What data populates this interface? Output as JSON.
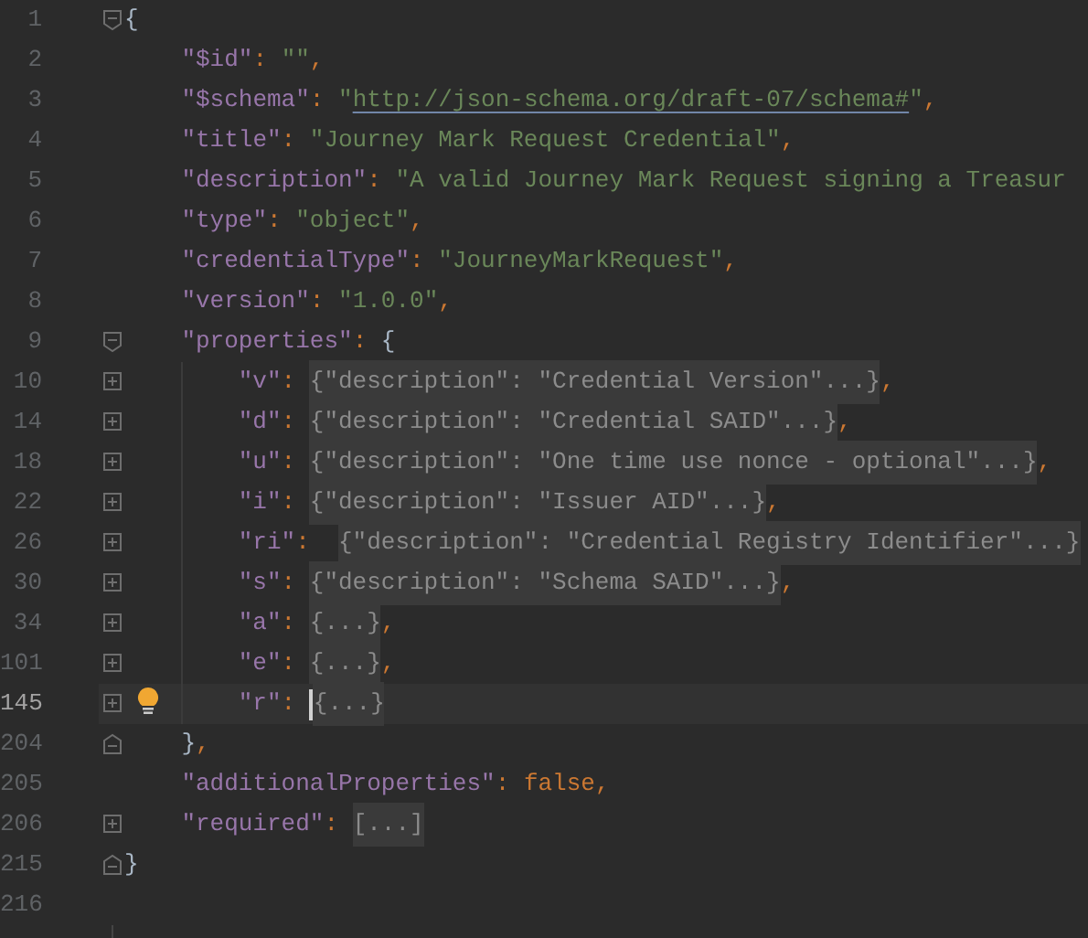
{
  "editor": {
    "lines": [
      {
        "number": "1",
        "expanded": true,
        "tokens": [
          {
            "kind": "brace",
            "text": "{"
          }
        ],
        "children": [
          {
            "number": "2",
            "tokens": [
              {
                "kind": "key",
                "text": "\"$id\""
              },
              {
                "kind": "punct",
                "text": ": "
              },
              {
                "kind": "string",
                "text": "\"\""
              },
              {
                "kind": "punct",
                "text": ","
              }
            ]
          },
          {
            "number": "3",
            "tokens": [
              {
                "kind": "key",
                "text": "\"$schema\""
              },
              {
                "kind": "punct",
                "text": ": "
              },
              {
                "kind": "string",
                "text": "\""
              },
              {
                "kind": "link",
                "text": "http://json-schema.org/draft-07/schema#"
              },
              {
                "kind": "string",
                "text": "\""
              },
              {
                "kind": "punct",
                "text": ","
              }
            ]
          },
          {
            "number": "4",
            "tokens": [
              {
                "kind": "key",
                "text": "\"title\""
              },
              {
                "kind": "punct",
                "text": ": "
              },
              {
                "kind": "string",
                "text": "\"Journey Mark Request Credential\""
              },
              {
                "kind": "punct",
                "text": ","
              }
            ]
          },
          {
            "number": "5",
            "tokens": [
              {
                "kind": "key",
                "text": "\"description\""
              },
              {
                "kind": "punct",
                "text": ": "
              },
              {
                "kind": "string",
                "text": "\"A valid Journey Mark Request signing a Treasur"
              }
            ]
          },
          {
            "number": "6",
            "tokens": [
              {
                "kind": "key",
                "text": "\"type\""
              },
              {
                "kind": "punct",
                "text": ": "
              },
              {
                "kind": "string",
                "text": "\"object\""
              },
              {
                "kind": "punct",
                "text": ","
              }
            ]
          },
          {
            "number": "7",
            "tokens": [
              {
                "kind": "key",
                "text": "\"credentialType\""
              },
              {
                "kind": "punct",
                "text": ": "
              },
              {
                "kind": "string",
                "text": "\"JourneyMarkRequest\""
              },
              {
                "kind": "punct",
                "text": ","
              }
            ]
          },
          {
            "number": "8",
            "tokens": [
              {
                "kind": "key",
                "text": "\"version\""
              },
              {
                "kind": "punct",
                "text": ": "
              },
              {
                "kind": "string",
                "text": "\"1.0.0\""
              },
              {
                "kind": "punct",
                "text": ","
              }
            ]
          },
          {
            "number": "9",
            "expanded": true,
            "tokens": [
              {
                "kind": "key",
                "text": "\"properties\""
              },
              {
                "kind": "punct",
                "text": ": "
              },
              {
                "kind": "brace",
                "text": "{"
              }
            ],
            "children": [
              {
                "number": "10",
                "expanded": false,
                "tokens": [
                  {
                    "kind": "key",
                    "text": "\"v\""
                  },
                  {
                    "kind": "punct",
                    "text": ": "
                  },
                  {
                    "kind": "folded",
                    "text": "{\"description\": \"Credential Version\"...}"
                  },
                  {
                    "kind": "punct",
                    "text": ","
                  }
                ]
              },
              {
                "number": "14",
                "expanded": false,
                "tokens": [
                  {
                    "kind": "key",
                    "text": "\"d\""
                  },
                  {
                    "kind": "punct",
                    "text": ": "
                  },
                  {
                    "kind": "folded",
                    "text": "{\"description\": \"Credential SAID\"...}"
                  },
                  {
                    "kind": "punct",
                    "text": ","
                  }
                ]
              },
              {
                "number": "18",
                "expanded": false,
                "tokens": [
                  {
                    "kind": "key",
                    "text": "\"u\""
                  },
                  {
                    "kind": "punct",
                    "text": ": "
                  },
                  {
                    "kind": "folded",
                    "text": "{\"description\": \"One time use nonce - optional\"...}"
                  },
                  {
                    "kind": "punct",
                    "text": ","
                  }
                ]
              },
              {
                "number": "22",
                "expanded": false,
                "tokens": [
                  {
                    "kind": "key",
                    "text": "\"i\""
                  },
                  {
                    "kind": "punct",
                    "text": ": "
                  },
                  {
                    "kind": "folded",
                    "text": "{\"description\": \"Issuer AID\"...}"
                  },
                  {
                    "kind": "punct",
                    "text": ","
                  }
                ]
              },
              {
                "number": "26",
                "expanded": false,
                "tokens": [
                  {
                    "kind": "key",
                    "text": "\"ri\""
                  },
                  {
                    "kind": "punct",
                    "text": ":  "
                  },
                  {
                    "kind": "folded",
                    "text": "{\"description\": \"Credential Registry Identifier\"...}"
                  }
                ]
              },
              {
                "number": "30",
                "expanded": false,
                "tokens": [
                  {
                    "kind": "key",
                    "text": "\"s\""
                  },
                  {
                    "kind": "punct",
                    "text": ": "
                  },
                  {
                    "kind": "folded",
                    "text": "{\"description\": \"Schema SAID\"...}"
                  },
                  {
                    "kind": "punct",
                    "text": ","
                  }
                ]
              },
              {
                "number": "34",
                "expanded": false,
                "tokens": [
                  {
                    "kind": "key",
                    "text": "\"a\""
                  },
                  {
                    "kind": "punct",
                    "text": ": "
                  },
                  {
                    "kind": "folded",
                    "text": "{...}"
                  },
                  {
                    "kind": "punct",
                    "text": ","
                  }
                ]
              },
              {
                "number": "101",
                "expanded": false,
                "tokens": [
                  {
                    "kind": "key",
                    "text": "\"e\""
                  },
                  {
                    "kind": "punct",
                    "text": ": "
                  },
                  {
                    "kind": "folded",
                    "text": "{...}"
                  },
                  {
                    "kind": "punct",
                    "text": ","
                  }
                ]
              },
              {
                "number": "145",
                "expanded": false,
                "current": true,
                "bulb": true,
                "tokens": [
                  {
                    "kind": "key",
                    "text": "\"r\""
                  },
                  {
                    "kind": "punct",
                    "text": ": "
                  },
                  {
                    "kind": "folded",
                    "text": "{...}",
                    "cursor": true
                  }
                ]
              }
            ]
          },
          {
            "number": "204",
            "fold_end": true,
            "tokens": [
              {
                "kind": "brace",
                "text": "}"
              },
              {
                "kind": "punct",
                "text": ","
              }
            ]
          },
          {
            "number": "205",
            "tokens": [
              {
                "kind": "key",
                "text": "\"additionalProperties\""
              },
              {
                "kind": "punct",
                "text": ": "
              },
              {
                "kind": "keyword",
                "text": "false"
              },
              {
                "kind": "punct",
                "text": ","
              }
            ]
          },
          {
            "number": "206",
            "expanded": false,
            "tokens": [
              {
                "kind": "key",
                "text": "\"required\""
              },
              {
                "kind": "punct",
                "text": ": "
              },
              {
                "kind": "folded",
                "text": "[...]"
              }
            ]
          }
        ]
      },
      {
        "number": "215",
        "fold_end": true,
        "tokens": [
          {
            "kind": "brace",
            "text": "}"
          }
        ]
      },
      {
        "number": "216"
      }
    ]
  }
}
